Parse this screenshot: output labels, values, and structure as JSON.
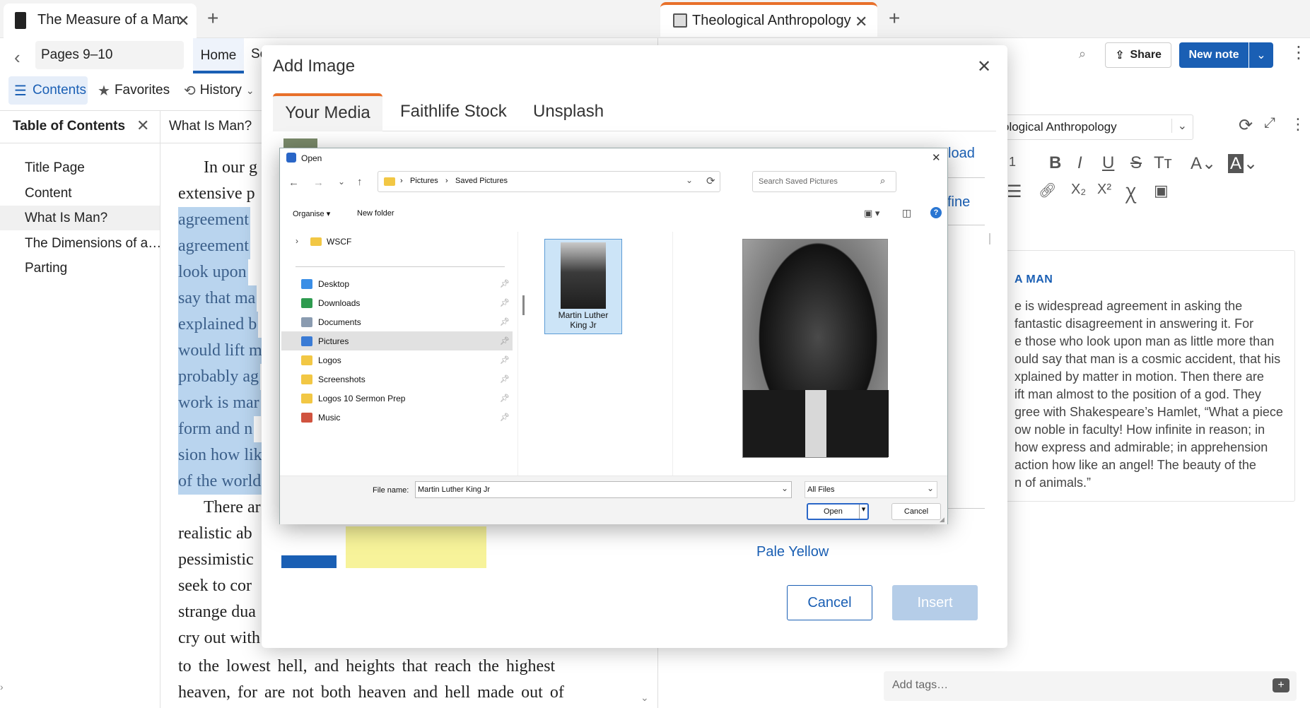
{
  "tabs": [
    {
      "title": "The Measure of a Man",
      "close": "✕"
    },
    {
      "title": "Theological Anthropology",
      "close": "✕"
    }
  ],
  "new_tab": "+",
  "reader": {
    "pages": "Pages 9–10",
    "home": "Home",
    "search_partial": "Se",
    "contents": "Contents",
    "favorites": "Favorites",
    "history": "History",
    "toc_title": "Table of Contents",
    "section_title": "What Is Man?",
    "toc": [
      "Title Page",
      "Content",
      "What Is Man?",
      "The Dimensions of a…",
      "Parting"
    ],
    "text_lines": [
      {
        "t": "In our g",
        "hl": false,
        "indent": true
      },
      {
        "t": "extensive p",
        "hl": false
      },
      {
        "t": "agreement",
        "hl": true
      },
      {
        "t": "agreement",
        "hl": true
      },
      {
        "t": "look  upon",
        "hl": true
      },
      {
        "t": "say that ma",
        "hl": true
      },
      {
        "t": "explained  b",
        "hl": true
      },
      {
        "t": "would  lift  m",
        "hl": true
      },
      {
        "t": "probably  ag",
        "hl": true
      },
      {
        "t": "work is mar",
        "hl": true
      },
      {
        "t": "form  and  n",
        "hl": true
      },
      {
        "t": "sion how lik",
        "hl": true
      },
      {
        "t": "of the world",
        "hl": true
      },
      {
        "t": "There ar",
        "hl": false,
        "indent": true
      },
      {
        "t": "realistic  ab",
        "hl": false
      },
      {
        "t": "pessimistic",
        "hl": false
      },
      {
        "t": "seek to cor",
        "hl": false
      },
      {
        "t": "strange dua",
        "hl": false
      },
      {
        "t": "cry out with",
        "hl": false
      }
    ],
    "bottom_lines": [
      "to  the  lowest  hell,  and  heights  that  reach  the  highest",
      "heaven,  for  are  not  both  heaven  and  hell  made  out  of"
    ]
  },
  "notes": {
    "share": "Share",
    "new_note": "New note",
    "doc_title": "ological Anthropology",
    "heading": "A MAN",
    "body_lines": [
      "e is widespread agreement in asking the",
      "fantastic disagreement in answering it. For",
      "e those who look upon man as little more than",
      "ould say that man is a cosmic accident, that his",
      "xplained by matter in motion. Then there are",
      "ift man almost to the position of a god. They",
      "gree with Shakespeare’s Hamlet, “What a piece",
      "ow noble in faculty! How infinite in reason; in",
      "how express and admirable; in apprehension",
      "action how like an angel! The beauty of the",
      "n of animals.”"
    ],
    "tags_placeholder": "Add tags…",
    "font_size_partial": "1"
  },
  "add_image": {
    "title": "Add Image",
    "tabs": [
      "Your Media",
      "Faithlife Stock",
      "Unsplash"
    ],
    "upload_partial": "load",
    "refine_partial": "fine",
    "color_label": "Pale Yellow",
    "cancel": "Cancel",
    "insert": "Insert",
    "colors": {
      "accent": "#e8702a",
      "blue": "#1a5fb4",
      "yellow": "#f7f39a"
    }
  },
  "open_dialog": {
    "title": "Open",
    "breadcrumb": [
      "Pictures",
      "Saved Pictures"
    ],
    "search_placeholder": "Search Saved Pictures",
    "organise": "Organise",
    "new_folder": "New folder",
    "tree_folder": "WSCF",
    "nav_items": [
      {
        "label": "Desktop",
        "icon": "desktop-icon",
        "color": "#3a8ee6"
      },
      {
        "label": "Downloads",
        "icon": "download-icon",
        "color": "#2e9b4f"
      },
      {
        "label": "Documents",
        "icon": "documents-icon",
        "color": "#8a9bb0"
      },
      {
        "label": "Pictures",
        "icon": "pictures-icon",
        "color": "#3a7bd5"
      },
      {
        "label": "Logos",
        "icon": "folder-icon",
        "color": "#f2c744"
      },
      {
        "label": "Screenshots",
        "icon": "folder-icon",
        "color": "#f2c744"
      },
      {
        "label": "Logos 10 Sermon Prep",
        "icon": "folder-icon",
        "color": "#f2c744"
      },
      {
        "label": "Music",
        "icon": "music-icon",
        "color": "#d0533f"
      }
    ],
    "file_item": "Martin Luther King Jr",
    "file_name_label": "File name:",
    "file_name_value": "Martin Luther King Jr",
    "file_type": "All Files",
    "open": "Open",
    "cancel": "Cancel"
  }
}
